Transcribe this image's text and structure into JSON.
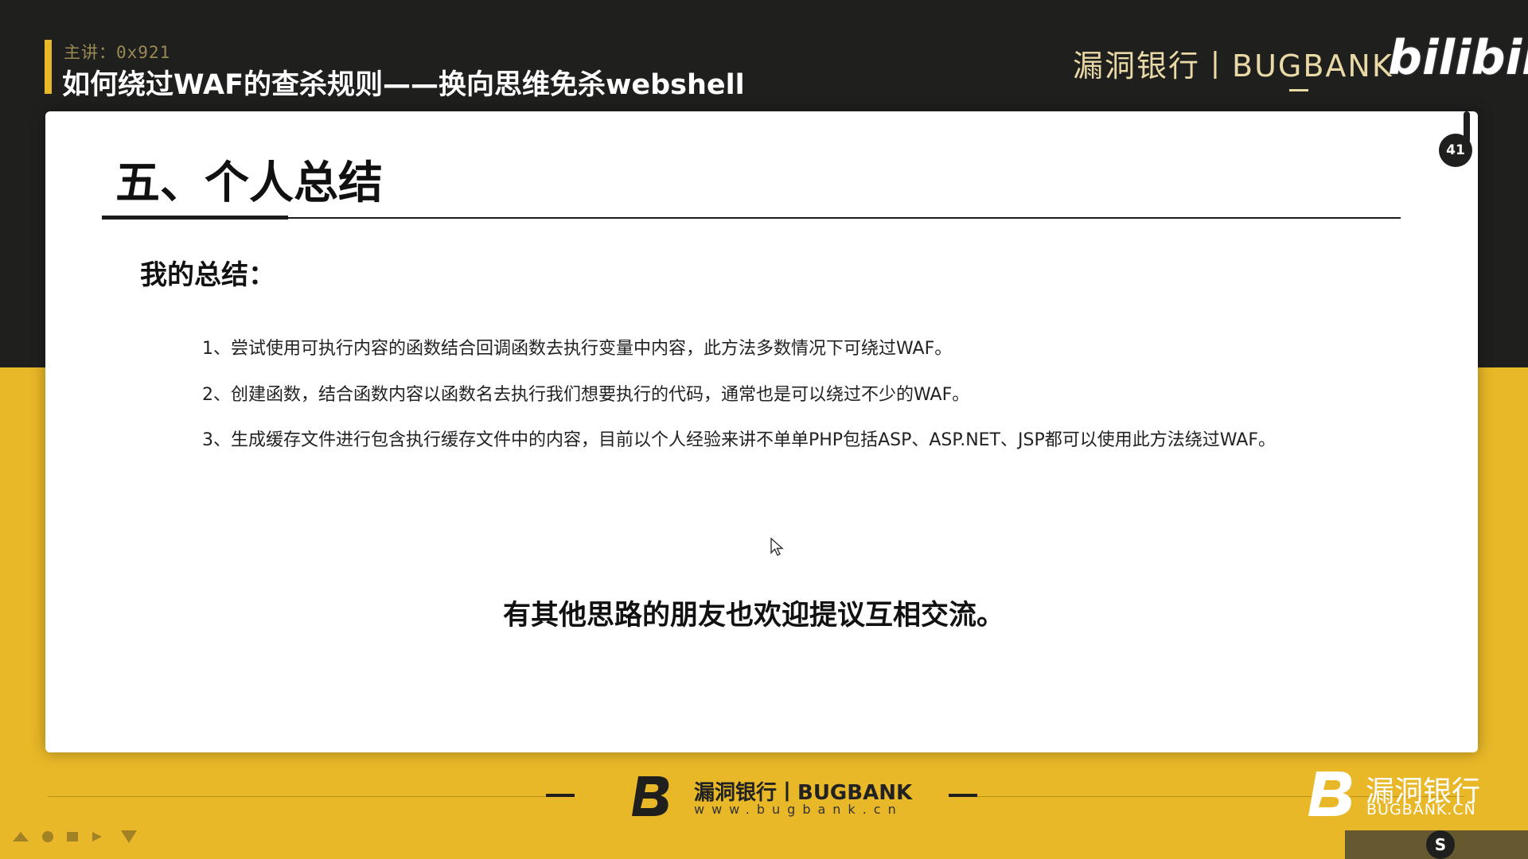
{
  "header": {
    "presenter": "主讲：0x921",
    "title": "如何绕过WAF的查杀规则——换向思维免杀webshell",
    "brand": "漏洞银行丨BUGBANK",
    "platform_logo": "bilibili"
  },
  "slide": {
    "page_number": "41",
    "section_title": "五、个人总结",
    "subheading": "我的总结：",
    "items": [
      "1、尝试使用可执行内容的函数结合回调函数去执行变量中内容，此方法多数情况下可绕过WAF。",
      "2、创建函数，结合函数内容以函数名去执行我们想要执行的代码，通常也是可以绕过不少的WAF。",
      "3、生成缓存文件进行包含执行缓存文件中的内容，目前以个人经验来讲不单单PHP包括ASP、ASP.NET、JSP都可以使用此方法绕过WAF。"
    ],
    "closing": "有其他思路的朋友也欢迎提议互相交流。"
  },
  "footer": {
    "brand": "漏洞银行丨BUGBANK",
    "url": "www.bugbank.cn",
    "corner_cn": "漏洞银行",
    "corner_en": "BUGBANK.CN",
    "taskbar_badge": "S"
  },
  "colors": {
    "dark": "#1f1f1e",
    "yellow": "#e9b828",
    "card": "#ffffff"
  }
}
